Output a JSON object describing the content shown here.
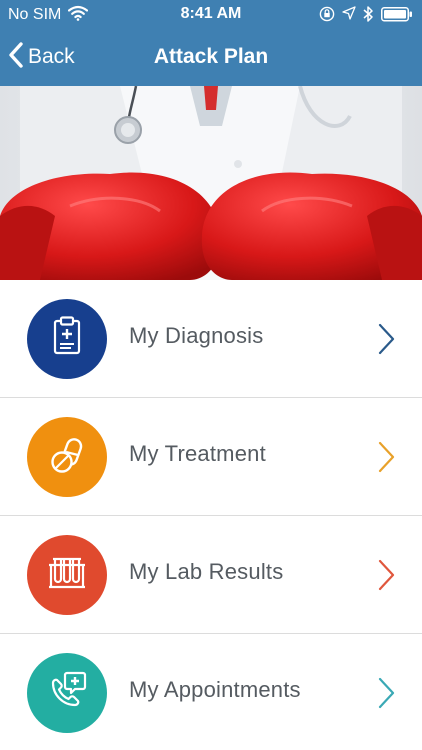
{
  "status_bar": {
    "carrier": "No SIM",
    "time": "8:41 AM"
  },
  "nav": {
    "back_label": "Back",
    "title": "Attack Plan"
  },
  "menu": [
    {
      "label": "My Diagnosis",
      "icon": "clipboard-medical-icon",
      "color": "#173f8e",
      "chevron_color": "#2a5a8a"
    },
    {
      "label": "My Treatment",
      "icon": "pills-icon",
      "color": "#f0900f",
      "chevron_color": "#e8a12a"
    },
    {
      "label": "My Lab Results",
      "icon": "test-tubes-icon",
      "color": "#e04a2e",
      "chevron_color": "#e0573d"
    },
    {
      "label": "My Appointments",
      "icon": "phone-medical-icon",
      "color": "#23aea2",
      "chevron_color": "#3aa9b5"
    }
  ],
  "colors": {
    "nav_bar": "#3f80b2",
    "separator": "#dcdcdc",
    "label_text": "#555b61"
  }
}
